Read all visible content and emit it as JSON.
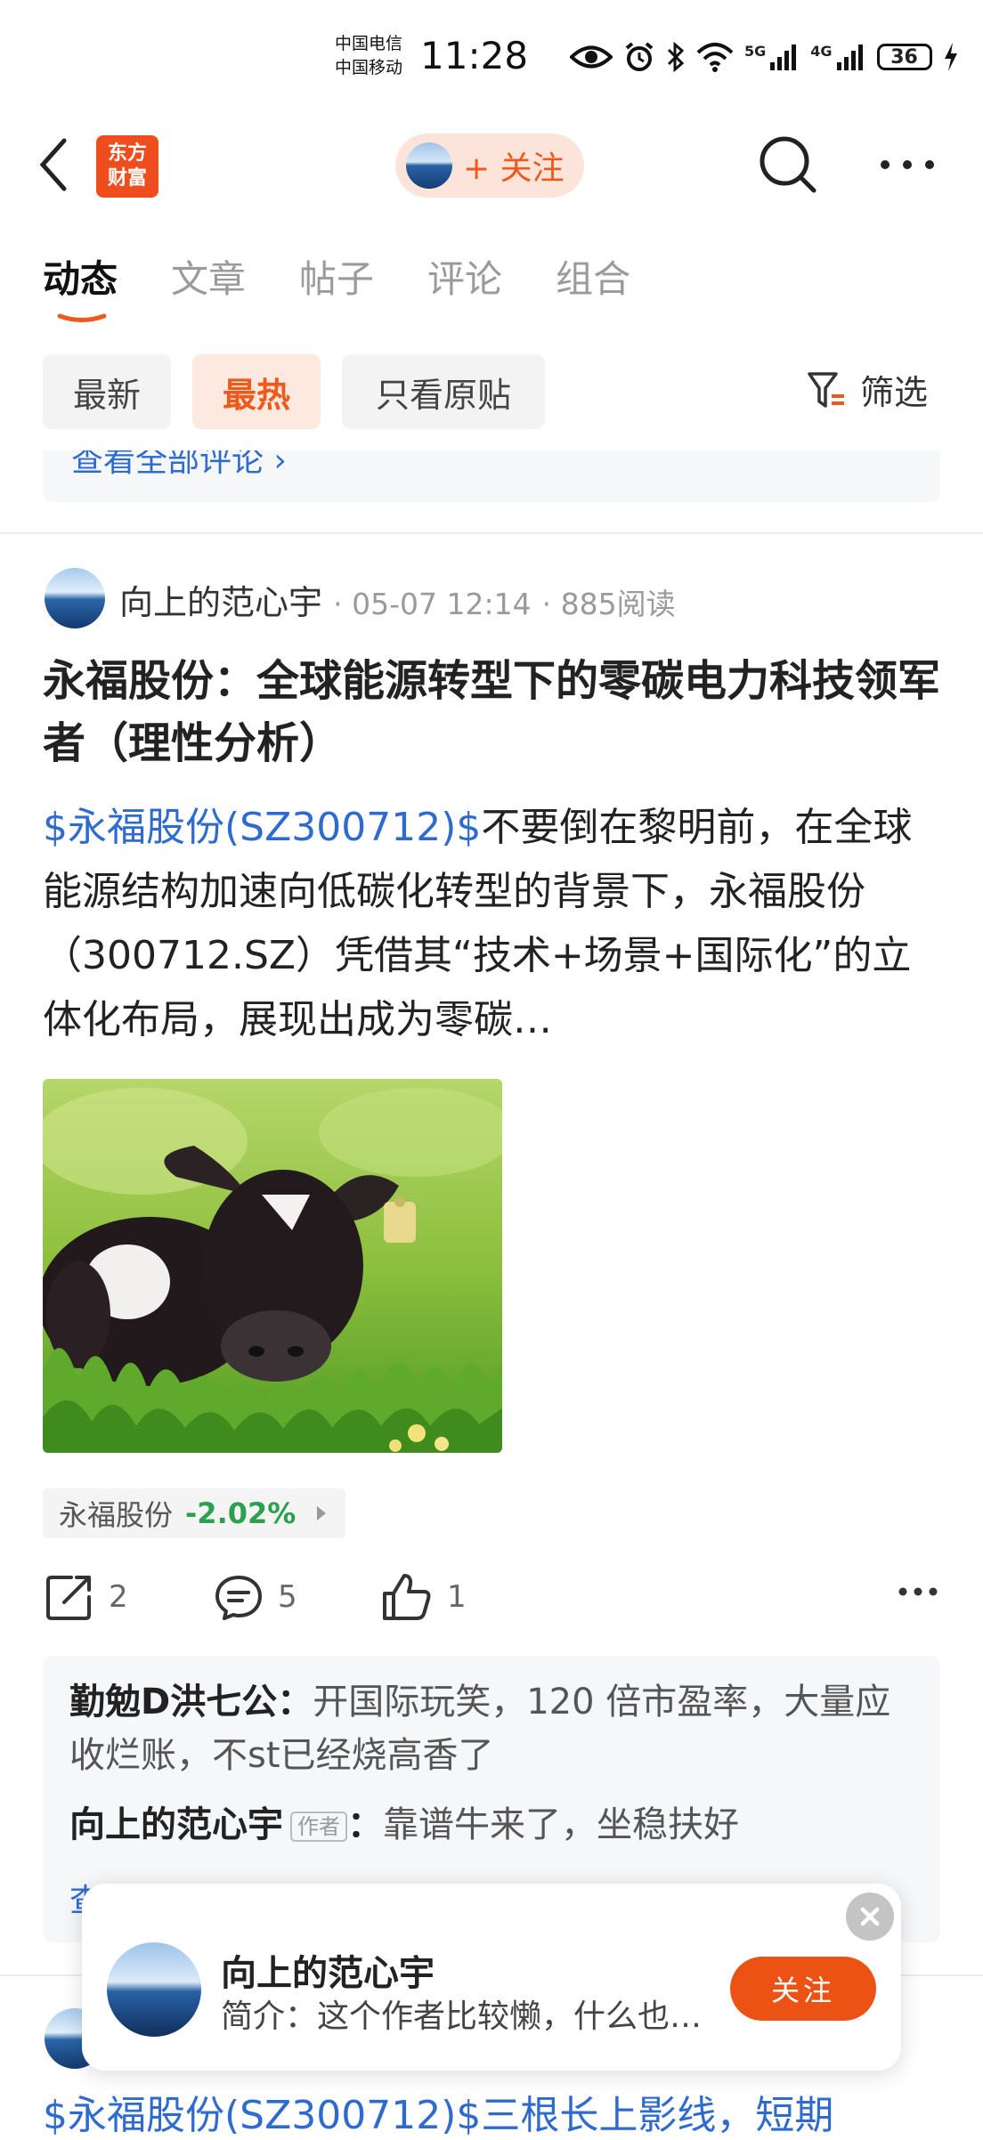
{
  "status_bar": {
    "carrier1": "中国电信",
    "carrier2": "中国移动",
    "time": "11:28",
    "net1": "5G",
    "net2": "4G",
    "battery": "36"
  },
  "header": {
    "logo_line1": "东方",
    "logo_line2": "财富",
    "follow_label": "+ 关注"
  },
  "tabs": [
    {
      "label": "动态",
      "active": true
    },
    {
      "label": "文章",
      "active": false
    },
    {
      "label": "帖子",
      "active": false
    },
    {
      "label": "评论",
      "active": false
    },
    {
      "label": "组合",
      "active": false
    }
  ],
  "filters": {
    "chips": [
      "最新",
      "最热",
      "只看原贴"
    ],
    "active": "最热",
    "filter_label": "筛选"
  },
  "prev_comments_link": "查看全部评论 ›",
  "post": {
    "author": "向上的范心宇",
    "date": "05-07 12:14",
    "reads": "885阅读",
    "title": "永福股份：全球能源转型下的零碳电力科技领军者（理性分析）",
    "stock_link": "$永福股份(SZ300712)$",
    "body": "不要倒在黎明前，在全球能源结构加速向低碳化转型的背景下，永福股份（300712.SZ）凭借其“技术+场景+国际化”的立体化布局，展现出成为零碳…",
    "stock_tag": {
      "name": "永福股份",
      "change": "-2.02%"
    },
    "shares": "2",
    "comments_count": "5",
    "likes": "1"
  },
  "comments": [
    {
      "user": "勤勉D洪七公",
      "sep": "：",
      "text": "开国际玩笑，120 倍市盈率，大量应收烂账，不st已经烧高香了"
    },
    {
      "user": "向上的范心宇",
      "badge": "作者",
      "sep": "：",
      "text": "靠谱牛来了，坐稳扶好"
    }
  ],
  "view_all": "查看全部评论",
  "next_post_text": "$永福股份(SZ300712)$三根长上影线，短期",
  "popup": {
    "name": "向上的范心宇",
    "bio": "简介：这个作者比较懒，什么也…",
    "follow": "关注"
  },
  "colors": {
    "accent": "#ee5a1b",
    "link": "#2f6bcf",
    "down": "#2ca04e"
  }
}
